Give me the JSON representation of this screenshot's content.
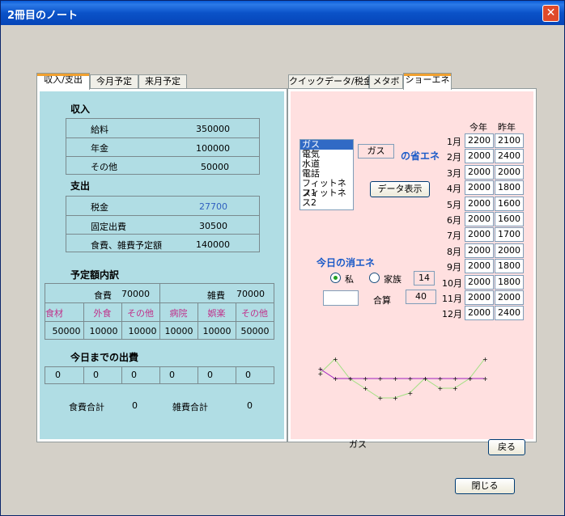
{
  "window": {
    "title": "2冊目のノート",
    "close_glyph": "✕"
  },
  "left_tabs": [
    "収入/支出",
    "今月予定",
    "来月予定"
  ],
  "right_tabs": [
    "クイックデータ/税金",
    "メタボ",
    "ショーエネ"
  ],
  "income": {
    "heading": "収入",
    "rows": [
      {
        "label": "給料",
        "value": "350000"
      },
      {
        "label": "年金",
        "value": "100000"
      },
      {
        "label": "その他",
        "value": "50000"
      }
    ]
  },
  "expense": {
    "heading": "支出",
    "rows": [
      {
        "label": "税金",
        "value": "27700"
      },
      {
        "label": "固定出費",
        "value": "30500"
      },
      {
        "label": "食費、雑費予定額",
        "value": "140000"
      }
    ]
  },
  "budget": {
    "heading": "予定額内訳",
    "food_label": "食費",
    "food_value": "70000",
    "misc_label": "雑費",
    "misc_value": "70000",
    "sub_headers": [
      "食材",
      "外食",
      "その他",
      "病院",
      "娯楽",
      "その他"
    ],
    "sub_values": [
      "50000",
      "10000",
      "10000",
      "10000",
      "10000",
      "50000"
    ]
  },
  "spent": {
    "heading": "今日までの出費",
    "values": [
      "0",
      "0",
      "0",
      "0",
      "0",
      "0"
    ],
    "food_total_label": "食費合計",
    "food_total": "0",
    "misc_total_label": "雑費合計",
    "misc_total": "0"
  },
  "energy": {
    "list_items": [
      "ガス",
      "電気",
      "水道",
      "電話",
      "フィットネス1",
      "フィットネス2"
    ],
    "selected_field": "ガス",
    "title_suffix": "の省エネ",
    "show_data_button": "データ表示",
    "today_label": "今日の消エネ",
    "radio_me": "私",
    "radio_family": "家族",
    "family_count": "14",
    "input_value": "",
    "total_label": "合算",
    "total_value": "40",
    "chart_label": "ガス",
    "back_button": "戻る"
  },
  "months": {
    "header_this_year": "今年",
    "header_last_year": "昨年",
    "rows": [
      {
        "m": "1月",
        "a": "2200",
        "b": "2100"
      },
      {
        "m": "2月",
        "a": "2000",
        "b": "2400"
      },
      {
        "m": "3月",
        "a": "2000",
        "b": "2000"
      },
      {
        "m": "4月",
        "a": "2000",
        "b": "1800"
      },
      {
        "m": "5月",
        "a": "2000",
        "b": "1600"
      },
      {
        "m": "6月",
        "a": "2000",
        "b": "1600"
      },
      {
        "m": "7月",
        "a": "2000",
        "b": "1700"
      },
      {
        "m": "8月",
        "a": "2000",
        "b": "2000"
      },
      {
        "m": "9月",
        "a": "2000",
        "b": "1800"
      },
      {
        "m": "10月",
        "a": "2000",
        "b": "1800"
      },
      {
        "m": "11月",
        "a": "2000",
        "b": "2000"
      },
      {
        "m": "12月",
        "a": "2000",
        "b": "2400"
      }
    ]
  },
  "footer": {
    "close_button": "閉じる"
  },
  "colors": {
    "left_panel_bg": "#b0dde4",
    "right_panel_bg": "#ffe0e0",
    "line_this_year": "#a020c0",
    "line_last_year": "#a0e080"
  }
}
